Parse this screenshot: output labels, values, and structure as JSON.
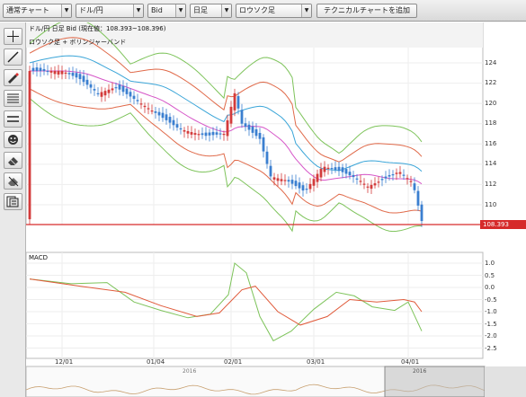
{
  "toolbar": {
    "chart_type": "通常チャート",
    "pair": "ドル/円",
    "side": "Bid",
    "period": "日足",
    "style": "ロウソク足",
    "add_indicator": "テクニカルチャートを追加"
  },
  "chart": {
    "header": "ドル/円 日足 Bid (現在値：108.393~108.396)",
    "main_legend": "ロウソク足 + ボリンジャーバンド",
    "sub_title": "MACD",
    "current_price": "108.393",
    "price_ticks": [
      "124",
      "122",
      "120",
      "118",
      "116",
      "114",
      "112",
      "110"
    ],
    "macd_ticks": [
      "1.0",
      "0.5",
      "0.0",
      "-0.5",
      "-1.0",
      "-1.5",
      "-2.0",
      "-2.5"
    ],
    "x_ticks": [
      "12/01",
      "01/04",
      "02/01",
      "03/01",
      "04/01"
    ],
    "nav_labels": [
      "2016",
      "2016"
    ]
  },
  "colors": {
    "candle_up": "#d33b3b",
    "candle_down": "#3b7fd0",
    "band_outer": "#7dc35a",
    "band_mid": "#e06a4a",
    "band_inner": "#3aa5d8",
    "ma": "#d656c8",
    "price_line": "#d62a2a",
    "macd_line": "#7dc35a",
    "signal_line": "#e05a3a"
  },
  "icons": [
    "crosshair-icon",
    "trendline-icon",
    "pencil-icon",
    "horizontal-lines-icon",
    "parallel-lines-icon",
    "face-icon",
    "eraser-icon",
    "delete-drawing-icon",
    "settings-panel-icon"
  ]
}
